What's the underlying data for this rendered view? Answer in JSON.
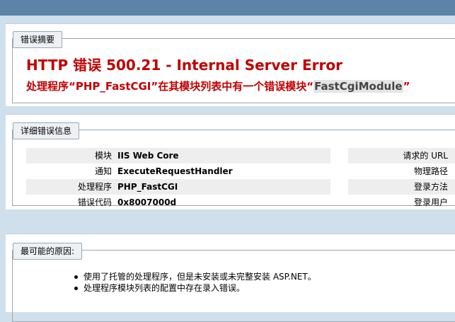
{
  "summary": {
    "legend": "错误摘要",
    "title": "HTTP 错误 500.21 - Internal Server Error",
    "desc_prefix": "处理程序“PHP_FastCGI”在其模块列表中有一个错误模块“",
    "desc_module": "FastCgiModule",
    "desc_suffix": "”"
  },
  "detail": {
    "legend": "详细错误信息",
    "left_rows": [
      {
        "label": "模块",
        "value": "IIS Web Core"
      },
      {
        "label": "通知",
        "value": "ExecuteRequestHandler"
      },
      {
        "label": "处理程序",
        "value": "PHP_FastCGI"
      },
      {
        "label": "错误代码",
        "value": "0x8007000d"
      }
    ],
    "right_rows": [
      {
        "label": "请求的 URL"
      },
      {
        "label": "物理路径"
      },
      {
        "label": "登录方法"
      },
      {
        "label": "登录用户"
      }
    ]
  },
  "causes": {
    "legend": "最可能的原因:",
    "items": [
      "使用了托管的处理程序，但是未安装或未完整安装 ASP.NET。",
      "处理程序模块列表的配置中存在录入错误。"
    ]
  }
}
